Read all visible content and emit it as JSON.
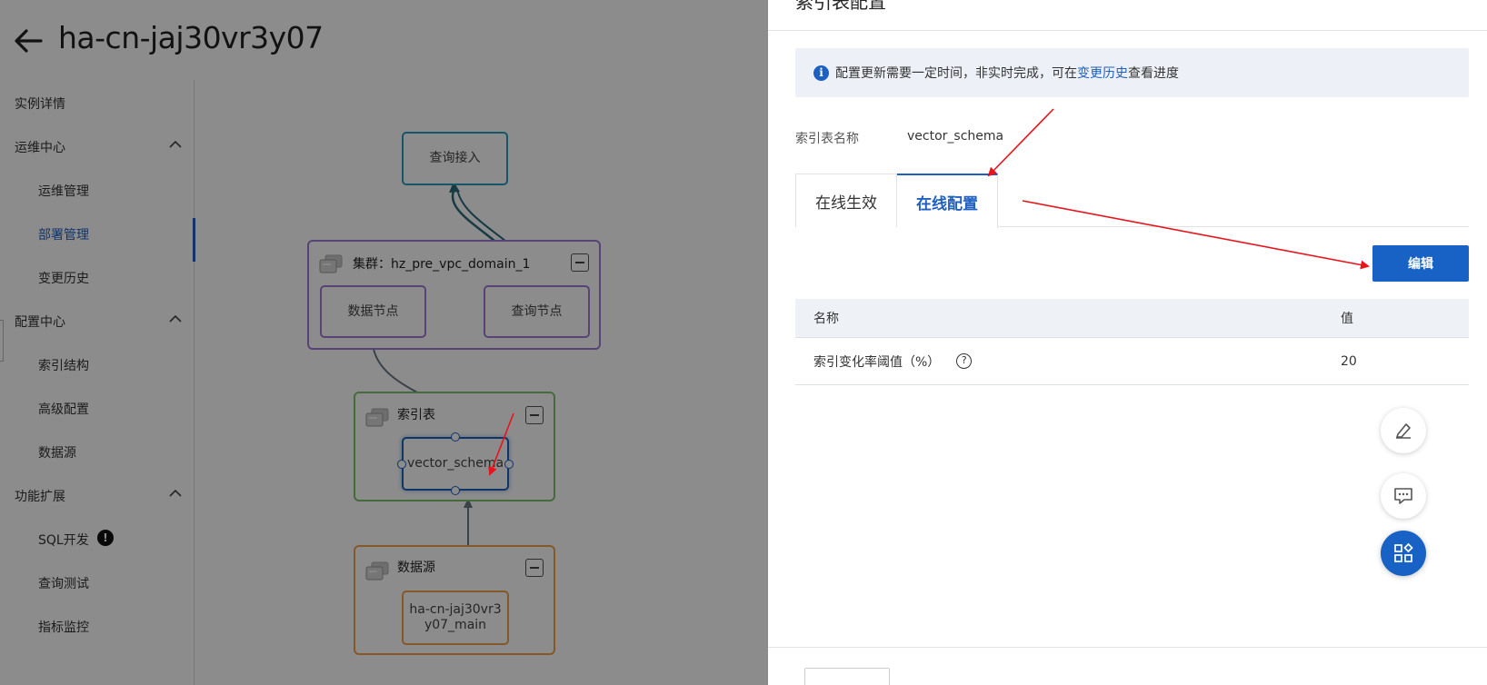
{
  "page": {
    "title": "ha-cn-jaj30vr3y07"
  },
  "sidebar": {
    "items": [
      {
        "label": "实例详情"
      },
      {
        "label": "运维中心"
      },
      {
        "label": "运维管理"
      },
      {
        "label": "部署管理"
      },
      {
        "label": "变更历史"
      },
      {
        "label": "配置中心"
      },
      {
        "label": "索引结构"
      },
      {
        "label": "高级配置"
      },
      {
        "label": "数据源"
      },
      {
        "label": "功能扩展"
      },
      {
        "label": "SQL开发"
      },
      {
        "label": "查询测试"
      },
      {
        "label": "指标监控"
      }
    ],
    "sql_badge": "!"
  },
  "diagram": {
    "query_access": "查询接入",
    "cluster_label": "集群：hz_pre_vpc_domain_1",
    "data_node": "数据节点",
    "query_node": "查询节点",
    "index_table_group": "索引表",
    "index_table_node": "vector_schema",
    "datasource_group": "数据源",
    "datasource_node": "ha-cn-jaj30vr3y07_main"
  },
  "drawer": {
    "title": "索引表配置",
    "notice_prefix": "配置更新需要一定时间，非实时完成，可在",
    "notice_link": "变更历史",
    "notice_suffix": "查看进度",
    "field_label": "索引表名称",
    "field_value": "vector_schema",
    "tabs": [
      {
        "label": "在线生效"
      },
      {
        "label": "在线配置"
      }
    ],
    "edit_button": "编辑",
    "table": {
      "headers": [
        "名称",
        "值"
      ],
      "rows": [
        {
          "name": "索引变化率阈值（%）",
          "value": "20"
        }
      ]
    }
  },
  "icons": {
    "back": "arrow-left-icon",
    "info": "info-icon",
    "help": "question-circle-icon",
    "float_1": "edit-pencil-icon",
    "float_2": "chat-bubble-icon",
    "float_3": "apps-grid-icon"
  },
  "colors": {
    "accent": "#1f5fbf",
    "primary_button": "#1762c4",
    "query_access_border": "#2a9bc0",
    "cluster_border": "#a078d8",
    "index_group_border": "#7ec46a",
    "datasource_border": "#f0a04b",
    "annotation_arrow": "#e8141c"
  }
}
